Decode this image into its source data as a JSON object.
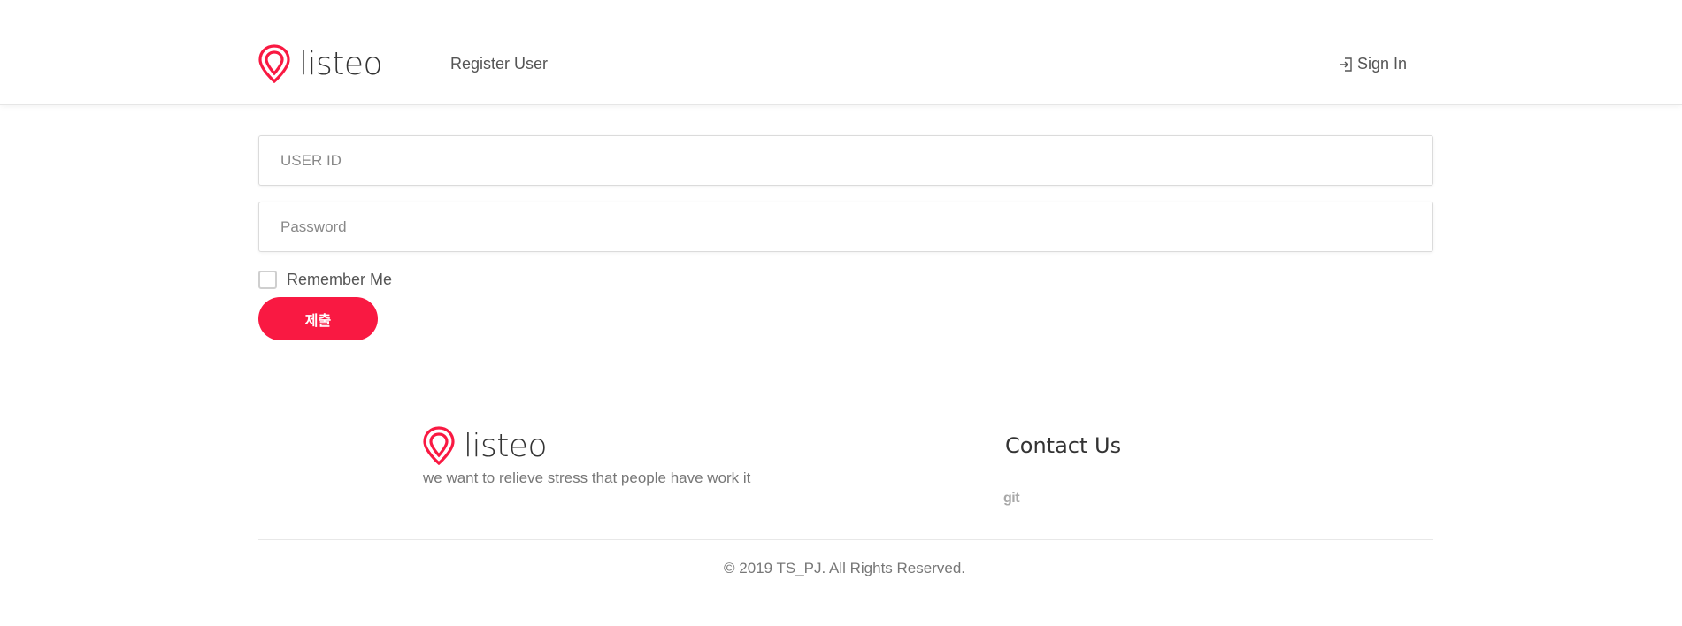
{
  "header": {
    "logo_text": "listeo",
    "nav_register": "Register User",
    "nav_signin": "Sign In"
  },
  "form": {
    "user_id_placeholder": "USER ID",
    "user_id_value": "",
    "password_placeholder": "Password",
    "password_value": "",
    "remember_label": "Remember Me",
    "remember_checked": false,
    "submit_label": "제출"
  },
  "footer": {
    "logo_text": "listeo",
    "tagline": "we want to relieve stress that people have work it",
    "contact_title": "Contact Us",
    "git_link": "git",
    "copyright": "© 2019 TS_PJ. All Rights Reserved."
  },
  "colors": {
    "accent": "#f91942",
    "logo_pink": "#f91942",
    "text_dark": "#333333",
    "text_muted": "#777777"
  },
  "icons": {
    "logo": "map-pin-icon",
    "signin": "sign-in-icon"
  }
}
